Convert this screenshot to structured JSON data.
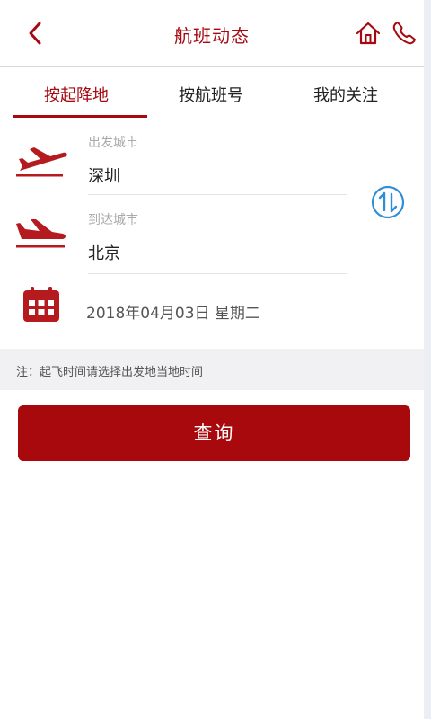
{
  "header": {
    "title": "航班动态",
    "back_icon": "chevron-left-icon",
    "home_icon": "home-icon",
    "phone_icon": "phone-icon"
  },
  "tabs": [
    {
      "label": "按起降地",
      "active": true
    },
    {
      "label": "按航班号",
      "active": false
    },
    {
      "label": "我的关注",
      "active": false
    }
  ],
  "form": {
    "departure": {
      "label": "出发城市",
      "value": "深圳",
      "icon": "plane-takeoff-icon"
    },
    "arrival": {
      "label": "到达城市",
      "value": "北京",
      "icon": "plane-landing-icon"
    },
    "swap_icon": "swap-icon",
    "date": {
      "icon": "calendar-icon",
      "value": "2018年04月03日 星期二"
    }
  },
  "note": "注：起飞时间请选择出发地当地时间",
  "query_button": "查询",
  "colors": {
    "brand": "#a7090c",
    "swap_accent": "#2f8fd6"
  }
}
